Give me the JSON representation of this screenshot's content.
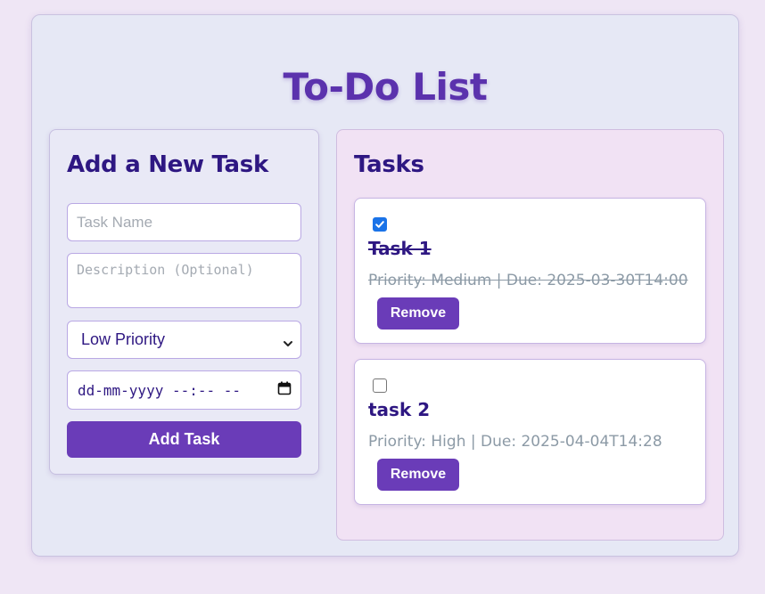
{
  "app": {
    "title": "To-Do List"
  },
  "add_panel": {
    "heading": "Add a New Task",
    "task_name_placeholder": "Task Name",
    "description_placeholder": "Description (Optional)",
    "priority_selected": "Low Priority",
    "due_placeholder": "dd-mm-yyyy --:-- --",
    "add_button": "Add Task"
  },
  "tasks_panel": {
    "heading": "Tasks",
    "tasks": [
      {
        "name": "Task 1",
        "meta": "Priority: Medium | Due: 2025-03-30T14:00",
        "completed": true,
        "remove_label": "Remove"
      },
      {
        "name": "task 2",
        "meta": "Priority: High | Due: 2025-04-04T14:28",
        "completed": false,
        "remove_label": "Remove"
      }
    ]
  },
  "colors": {
    "accent": "#6a3cb8",
    "title": "#5b32ad",
    "heading": "#2e1782",
    "meta_text": "#8c9aa6"
  }
}
